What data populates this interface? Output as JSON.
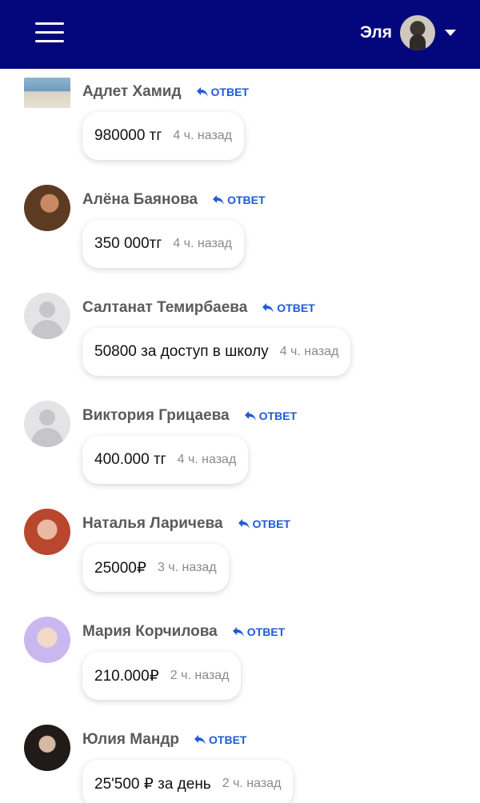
{
  "header": {
    "user_name": "Эля"
  },
  "comments": [
    {
      "name": "Адлет Хамид",
      "reply": "ОТВЕТ",
      "text": "980000 тг",
      "time": "4 ч. назад"
    },
    {
      "name": "Алёна Баянова",
      "reply": "ОТВЕТ",
      "text": "350 000тг",
      "time": "4 ч. назад"
    },
    {
      "name": "Салтанат Темирбаева",
      "reply": "ОТВЕТ",
      "text": "50800 за доступ в школу",
      "time": "4 ч. назад"
    },
    {
      "name": "Виктория Грицаева",
      "reply": "ОТВЕТ",
      "text": "400.000 тг",
      "time": "4 ч. назад"
    },
    {
      "name": "Наталья Ларичева",
      "reply": "ОТВЕТ",
      "text": "25000₽",
      "time": "3 ч. назад"
    },
    {
      "name": "Мария Корчилова",
      "reply": "ОТВЕТ",
      "text": "210.000₽",
      "time": "2 ч. назад"
    },
    {
      "name": "Юлия Мандр",
      "reply": "ОТВЕТ",
      "text": "25'500 ₽ за день",
      "time": "2 ч. назад"
    }
  ]
}
